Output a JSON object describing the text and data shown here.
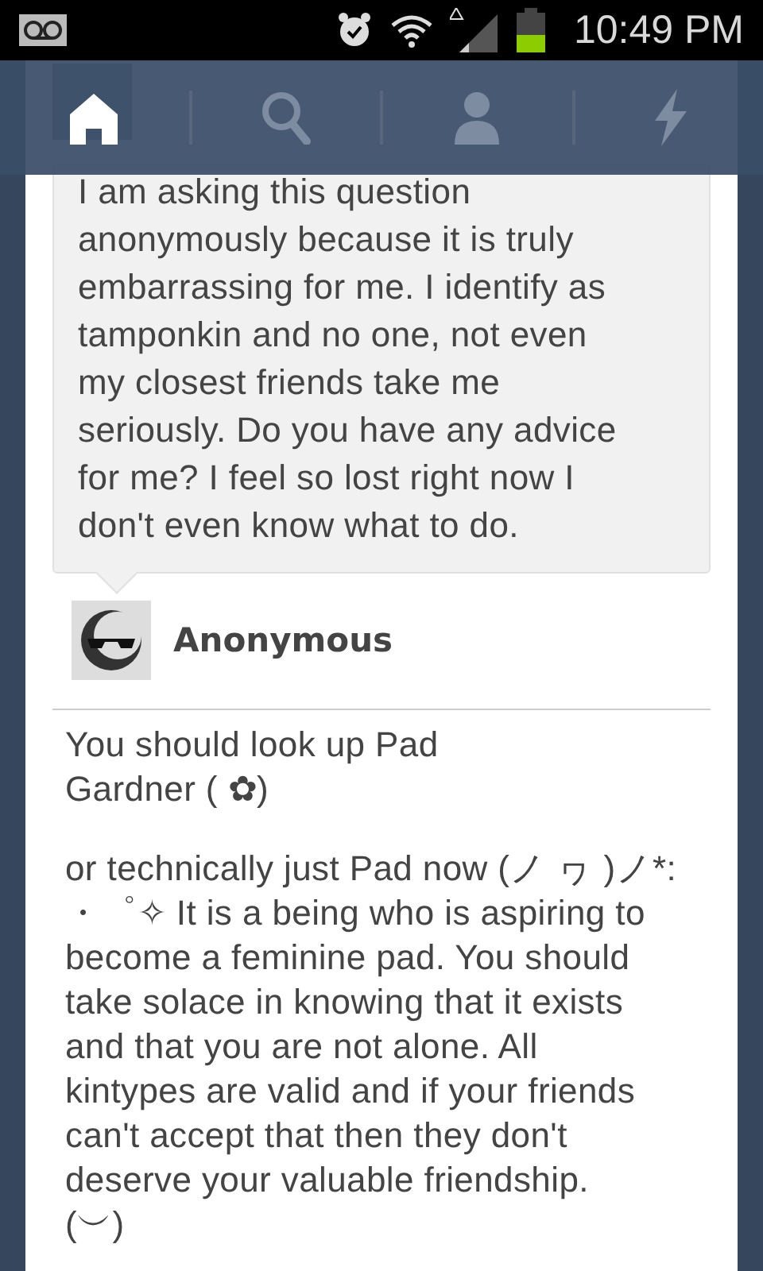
{
  "status_bar": {
    "time": "10:49 PM"
  },
  "nav": {
    "tabs": [
      {
        "kind": "home",
        "selected": true
      },
      {
        "kind": "search",
        "selected": false
      },
      {
        "kind": "account",
        "selected": false
      },
      {
        "kind": "activity",
        "selected": false
      }
    ]
  },
  "post": {
    "question": {
      "lines": [
        "I am asking this question",
        "anonymously because it is truly",
        "embarrassing for me. I identify as",
        "tamponkin and no one, not even",
        "my closest friends take me",
        "seriously. Do you have any advice",
        "for me? I feel so lost right now I",
        "don't even know what to do."
      ],
      "asker": "Anonymous"
    },
    "answer": [
      {
        "lines": [
          "You should look up Pad",
          "Gardner (   ✿)"
        ]
      },
      {
        "lines": [
          "or technically just Pad now (ノ ヮ )ノ*:",
          "・゜✧ It is a being who is aspiring to",
          "become a feminine pad. You should",
          "take solace in knowing that it exists",
          "and that you are not alone. All",
          "kintypes are valid and if your friends",
          "can't accept that then they don't",
          "deserve your valuable friendship.",
          "(︶)"
        ]
      }
    ]
  }
}
